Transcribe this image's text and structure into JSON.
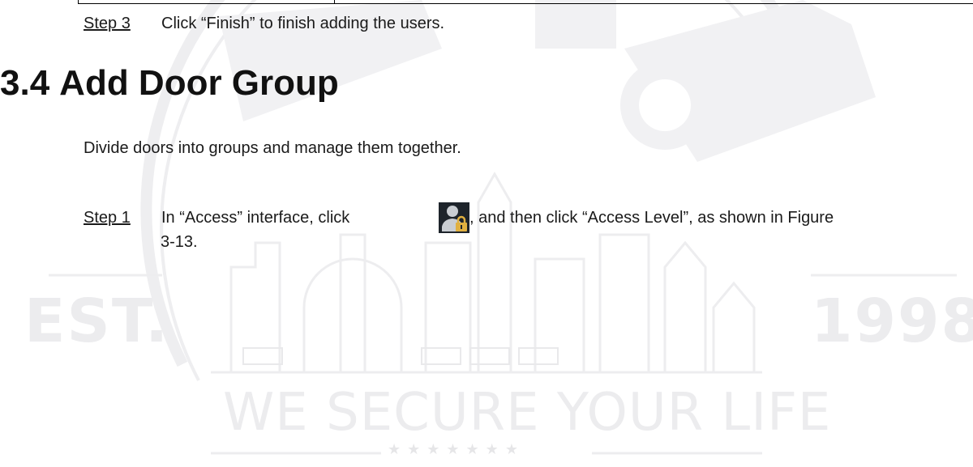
{
  "watermark": {
    "est": "EST.",
    "year": "1998",
    "slogan": "WE SECURE YOUR LIFE",
    "stars": "★★★★★★★"
  },
  "step3": {
    "label": "Step 3",
    "text": "Click “Finish” to finish adding the users."
  },
  "section": {
    "number": "3.4",
    "title": "Add Door Group"
  },
  "intro": "Divide doors into groups and manage them together.",
  "step1": {
    "label": "Step 1",
    "text_before_icon": "In “Access” interface, click",
    "icon": "person-lock-icon",
    "text_after_icon": ", and then click “Access Level”, as shown in Figure",
    "continuation": "3-13."
  },
  "colors": {
    "text": "#1a1a1a",
    "heading": "#111111",
    "watermark": "#ececee",
    "icon_background": "#1e242b",
    "icon_person": "#c9cdd2",
    "icon_lock": "#e0b040"
  }
}
